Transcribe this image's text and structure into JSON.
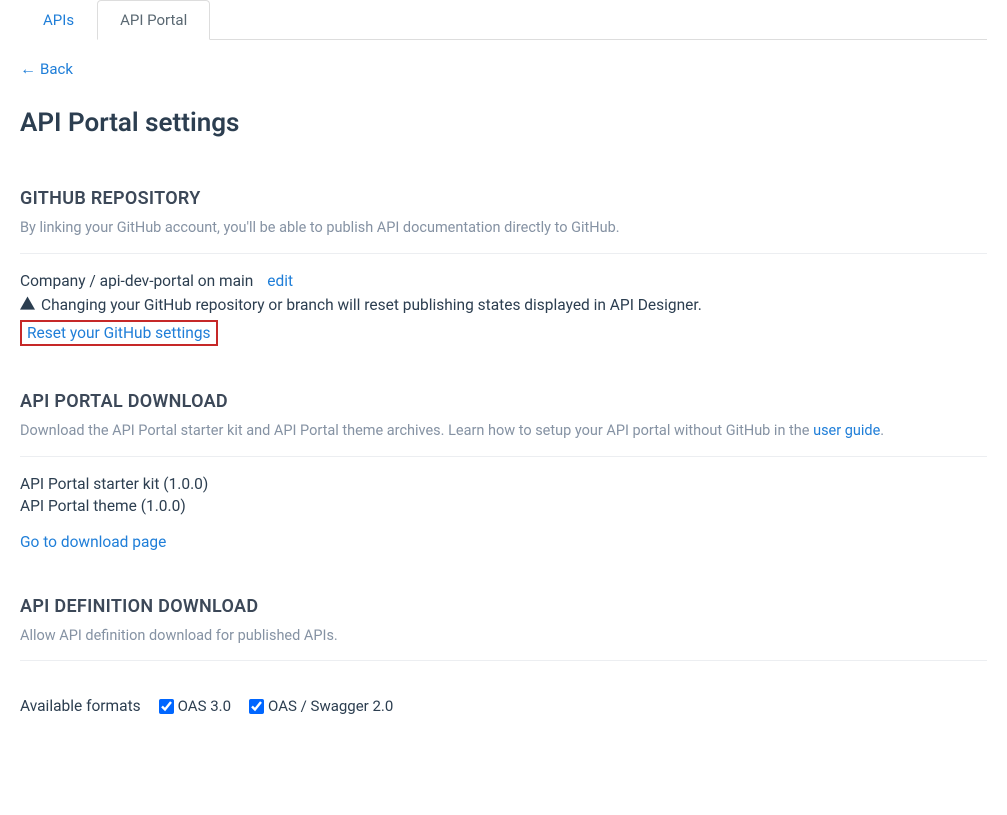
{
  "tabs": {
    "apis": "APIs",
    "portal": "API Portal"
  },
  "back": "Back",
  "pageTitle": "API Portal settings",
  "github": {
    "title": "GITHUB REPOSITORY",
    "desc": "By linking your GitHub account, you'll be able to publish API documentation directly to GitHub.",
    "repo": "Company / api-dev-portal on main",
    "edit": "edit",
    "warning": "Changing your GitHub repository or branch will reset publishing states displayed in API Designer.",
    "reset": "Reset your GitHub settings"
  },
  "download": {
    "title": "API PORTAL DOWNLOAD",
    "descPrefix": "Download the API Portal starter kit and API Portal theme archives. Learn how to setup your API portal without GitHub in the ",
    "userGuide": "user guide",
    "descSuffix": ".",
    "items": {
      "starter": "API Portal starter kit (1.0.0)",
      "theme": "API Portal theme (1.0.0)"
    },
    "link": "Go to download page"
  },
  "definition": {
    "title": "API DEFINITION DOWNLOAD",
    "desc": "Allow API definition download for published APIs.",
    "formatsLabel": "Available formats",
    "formats": {
      "oas3": "OAS 3.0",
      "oas2": "OAS / Swagger 2.0"
    }
  }
}
